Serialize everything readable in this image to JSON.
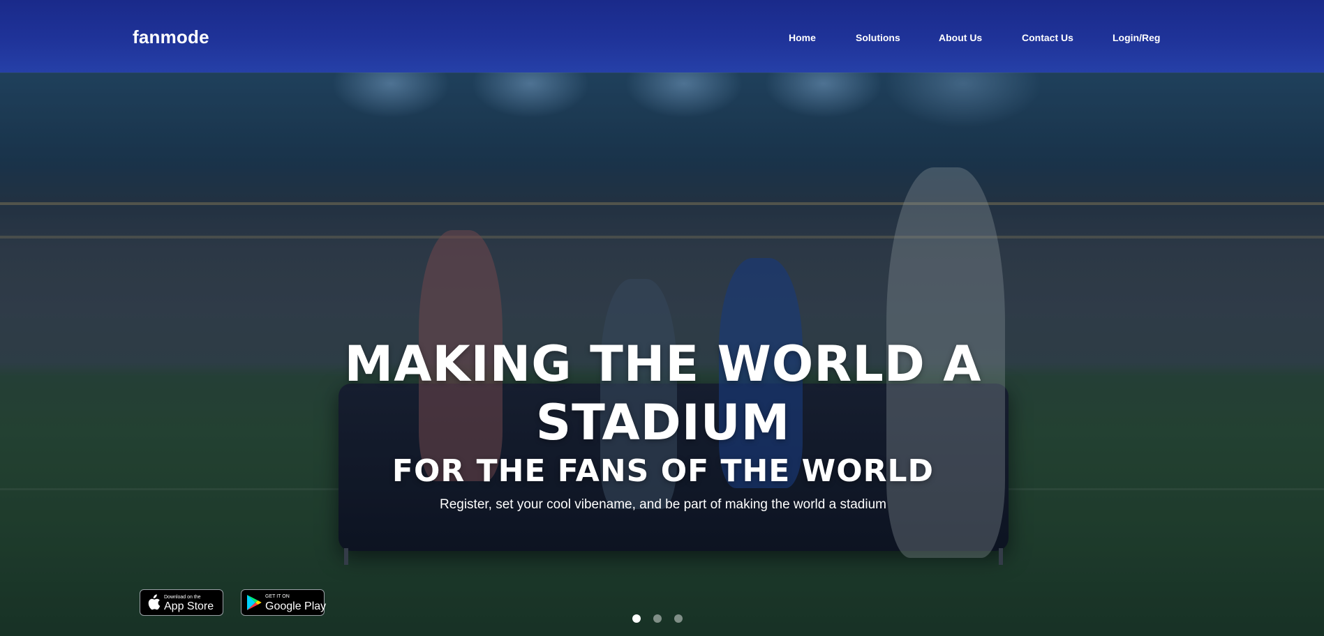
{
  "brand": {
    "name": "fanmode"
  },
  "nav": {
    "items": [
      {
        "label": "Home"
      },
      {
        "label": "Solutions"
      },
      {
        "label": "About Us"
      },
      {
        "label": "Contact Us"
      },
      {
        "label": "Login/Reg"
      }
    ]
  },
  "hero": {
    "headline_line1": "MAKING THE WORLD A",
    "headline_line2": "STADIUM",
    "subheadline": "FOR THE FANS OF THE WORLD",
    "tagline": "Register, set your cool vibename, and be part of making the world a stadium"
  },
  "badges": {
    "app_store": {
      "small": "Download on the",
      "big": "App Store",
      "icon": "apple-icon"
    },
    "google_play": {
      "small": "GET IT ON",
      "big": "Google Play",
      "icon": "google-play-icon"
    }
  },
  "carousel": {
    "slide_count": 3,
    "active_index": 0
  },
  "colors": {
    "navbar": "#1f3399",
    "text": "#ffffff",
    "badge_bg": "#000000"
  }
}
